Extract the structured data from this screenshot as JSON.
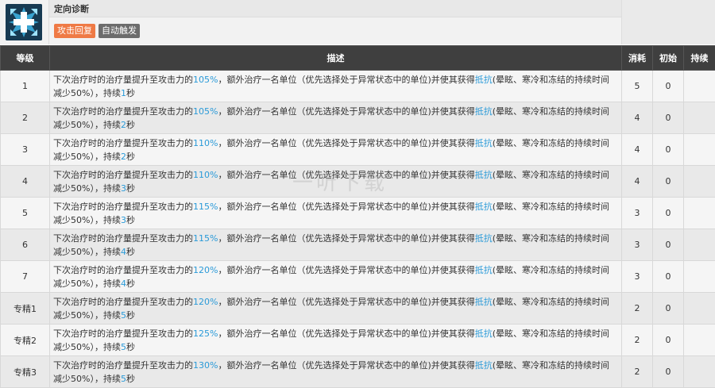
{
  "skill": {
    "name": "定向诊断",
    "tags": [
      "攻击回复",
      "自动触发"
    ],
    "icon": "medic-cross-icon"
  },
  "headers": {
    "level": "等级",
    "desc": "描述",
    "cost": "消耗",
    "initial": "初始",
    "duration": "持续"
  },
  "desc_parts": {
    "pre": "下次治疗时的治疗量提升至攻击力的",
    "mid": "，额外治疗一名单位（优先选择处于异常状态中的单位)并使其获得",
    "keyword": "抵抗",
    "post": "(晕眩、寒冷和冻结的持续时间减少50%），持续",
    "sec": "秒"
  },
  "rows": [
    {
      "level": "1",
      "pct": "105%",
      "sec": "1",
      "cost": "5",
      "initial": "0",
      "duration": ""
    },
    {
      "level": "2",
      "pct": "105%",
      "sec": "2",
      "cost": "4",
      "initial": "0",
      "duration": ""
    },
    {
      "level": "3",
      "pct": "110%",
      "sec": "2",
      "cost": "4",
      "initial": "0",
      "duration": ""
    },
    {
      "level": "4",
      "pct": "110%",
      "sec": "3",
      "cost": "4",
      "initial": "0",
      "duration": ""
    },
    {
      "level": "5",
      "pct": "115%",
      "sec": "3",
      "cost": "3",
      "initial": "0",
      "duration": ""
    },
    {
      "level": "6",
      "pct": "115%",
      "sec": "4",
      "cost": "3",
      "initial": "0",
      "duration": ""
    },
    {
      "level": "7",
      "pct": "120%",
      "sec": "4",
      "cost": "3",
      "initial": "0",
      "duration": ""
    },
    {
      "level": "专精1",
      "pct": "120%",
      "sec": "5",
      "cost": "2",
      "initial": "0",
      "duration": ""
    },
    {
      "level": "专精2",
      "pct": "125%",
      "sec": "5",
      "cost": "2",
      "initial": "0",
      "duration": ""
    },
    {
      "level": "专精3",
      "pct": "130%",
      "sec": "5",
      "cost": "2",
      "initial": "0",
      "duration": ""
    }
  ],
  "watermark": "一听下载",
  "colors": {
    "header_bg": "#3f3f3f",
    "value": "#2a9ad8",
    "tag_primary": "#ef7a45",
    "tag_secondary": "#6c6c6c"
  }
}
